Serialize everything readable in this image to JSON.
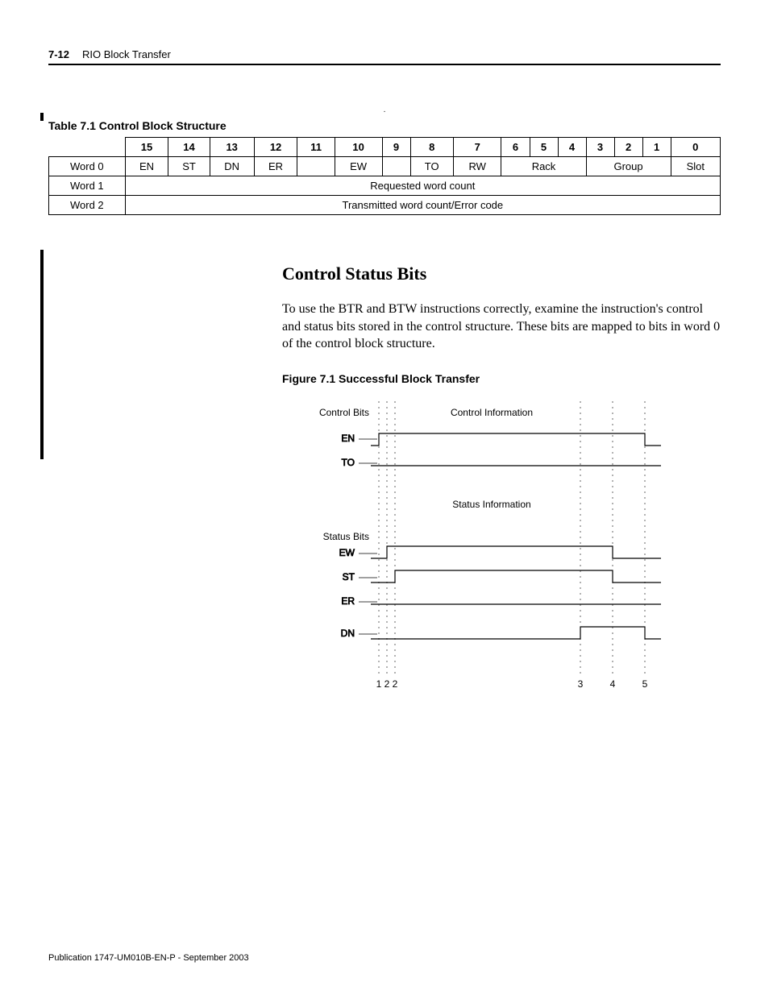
{
  "header": {
    "page_num": "7-12",
    "section": "RIO Block Transfer"
  },
  "table": {
    "caption": "Table 7.1 Control Block Structure",
    "bit_headers": [
      "15",
      "14",
      "13",
      "12",
      "11",
      "10",
      "9",
      "8",
      "7",
      "6",
      "5",
      "4",
      "3",
      "2",
      "1",
      "0"
    ],
    "rows": [
      {
        "label": "Word 0",
        "cells": [
          {
            "text": "EN",
            "span": 1
          },
          {
            "text": "ST",
            "span": 1
          },
          {
            "text": "DN",
            "span": 1
          },
          {
            "text": "ER",
            "span": 1
          },
          {
            "text": "",
            "span": 1
          },
          {
            "text": "EW",
            "span": 1
          },
          {
            "text": "",
            "span": 1
          },
          {
            "text": "TO",
            "span": 1
          },
          {
            "text": "RW",
            "span": 1
          },
          {
            "text": "Rack",
            "span": 3
          },
          {
            "text": "Group",
            "span": 3
          },
          {
            "text": "Slot",
            "span": 1
          }
        ]
      },
      {
        "label": "Word 1",
        "full": "Requested word count"
      },
      {
        "label": "Word 2",
        "full": "Transmitted word count/Error code"
      }
    ]
  },
  "section_heading": "Control Status Bits",
  "paragraph": "To use the BTR and BTW instructions correctly, examine the instruction's control and status bits stored in the control structure. These bits are mapped to bits in word 0 of the control block structure.",
  "figure": {
    "caption": "Figure 7.1 Successful Block Transfer",
    "labels": {
      "control_bits": "Control Bits",
      "control_info": "Control Information",
      "status_bits": "Status Bits",
      "status_info": "Status Information",
      "en": "EN",
      "to": "TO",
      "ew": "EW",
      "st": "ST",
      "er": "ER",
      "dn": "DN"
    },
    "ticks": [
      "1",
      "2",
      "2",
      "3",
      "4",
      "5"
    ]
  },
  "chart_data": {
    "type": "timing-diagram",
    "title": "Figure 7.1 Successful Block Transfer",
    "groups": [
      {
        "name": "Control Information",
        "signals": [
          {
            "name": "EN",
            "transitions": [
              {
                "t": 1,
                "level": "high"
              },
              {
                "t": 5,
                "level": "low"
              }
            ]
          },
          {
            "name": "TO",
            "transitions": []
          }
        ]
      },
      {
        "name": "Status Information",
        "signals": [
          {
            "name": "EW",
            "transitions": [
              {
                "t": 2,
                "level": "high"
              },
              {
                "t": 4,
                "level": "low"
              }
            ]
          },
          {
            "name": "ST",
            "transitions": [
              {
                "t": 2.2,
                "level": "high"
              },
              {
                "t": 4,
                "level": "low"
              }
            ]
          },
          {
            "name": "ER",
            "transitions": []
          },
          {
            "name": "DN",
            "transitions": [
              {
                "t": 3,
                "level": "high"
              },
              {
                "t": 5,
                "level": "low"
              }
            ]
          }
        ]
      }
    ],
    "time_markers": [
      1,
      2,
      2,
      3,
      4,
      5
    ]
  },
  "footer": "Publication 1747-UM010B-EN-P - September 2003"
}
